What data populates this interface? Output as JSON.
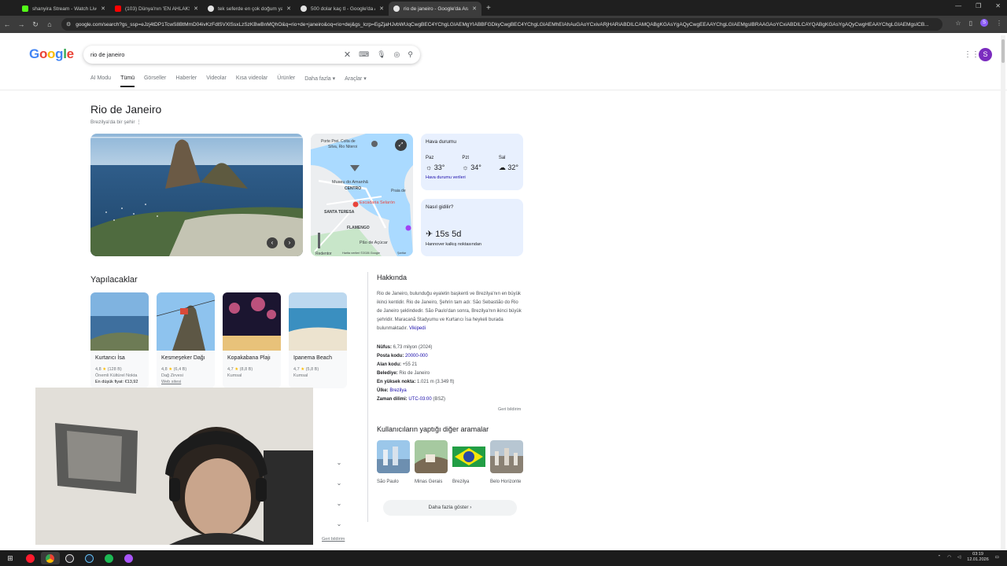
{
  "browser": {
    "tabs": [
      {
        "label": "shanyira Stream - Watch Live o",
        "color": "#53fc18",
        "active": false
      },
      {
        "label": "(103) Dünya'nın 'EN AHLAKSIZ'",
        "color": "#ff0000",
        "active": false
      },
      {
        "label": "tek seferde en çok doğum yapa",
        "color": "#e3e3e3",
        "active": false
      },
      {
        "label": "500 dolar kaç tl - Google'da Ara",
        "color": "#e3e3e3",
        "active": false
      },
      {
        "label": "rio de janeiro - Google'da Ara",
        "color": "#e3e3e3",
        "active": true
      }
    ],
    "url": "google.com/search?gs_ssp=eJzj4tDP1TcwS8BtMmD04ivKzFdlSVXlSsxLzSzKBwBnMQhO&q=rio+de+janeiro&oq=rio+dej&gs_lcrp=EgZjaHJvbWUqCwgBEC4YChgLGIAEMgYIABBFGDkyCwgBEC4YChgLGIAEMhEIAhAuGAoYCxivARjHARiABDILCAMQABgKGAsYgAQyCwgEEAAYChgLGIAEMgsIBRAAGAoYCxiABDILCAYQABgKGAsYgAQyCwgHEAAYChgLGIAEMgsICB..."
  },
  "search": {
    "query": "rio de janeiro",
    "nav_tabs": [
      "AI Modu",
      "Tümü",
      "Görseller",
      "Haberler",
      "Videolar",
      "Kısa videolar",
      "Ürünler",
      "Daha fazla ▾",
      "Araçlar ▾"
    ],
    "selected_tab": "Tümü",
    "avatar_letter": "S"
  },
  "entity": {
    "title": "Rio de Janeiro",
    "subtitle": "Brezilya'da bir şehir",
    "map_labels": {
      "porte": "Porte Prei. Colta de",
      "silva": "Silva, Rio Niteroi",
      "museu": "Museu do Amanhã",
      "centro": "CENTRO",
      "escadaria": "Escadaria Selarón",
      "santa": "SANTA TERESA",
      "flamengo": "FLAMENGO",
      "pao": "Pão de Açúcar",
      "redentor": "Redentor",
      "praia": "Praia de",
      "credit": "Harita verileri ©2026 Google",
      "terms": "Şartlar"
    },
    "weather": {
      "title": "Hava durumu",
      "days": [
        {
          "name": "Paz",
          "temp": "33°",
          "icon": "☼"
        },
        {
          "name": "Pzt",
          "temp": "34°",
          "icon": "☼"
        },
        {
          "name": "Sal",
          "temp": "32°",
          "icon": "☁"
        }
      ],
      "source": "Hava durumu verileri"
    },
    "travel": {
      "title": "Nasıl gidilir?",
      "time": "15s 5d",
      "from": "Hannover kalkış noktasından"
    }
  },
  "todo": {
    "title": "Yapılacaklar",
    "cards": [
      {
        "name": "Kurtarıcı İsa",
        "rating": "4,8",
        "reviews": "(128 B)",
        "cat": "Önemli Kültürel Nokta",
        "extra": "En düşük fiyat: €13,92",
        "extra_link": false
      },
      {
        "name": "Kesmeşeker Dağı",
        "rating": "4,8",
        "reviews": "(6,4 B)",
        "cat": "Dağ Zirvesi",
        "extra": "Web sitesi",
        "extra_link": true
      },
      {
        "name": "Kopakabana Plajı",
        "rating": "4,7",
        "reviews": "(8,8 B)",
        "cat": "Kumsal",
        "extra": "",
        "extra_link": false
      },
      {
        "name": "Ipanema Beach",
        "rating": "4,7",
        "reviews": "(5,8 B)",
        "cat": "Kumsal",
        "extra": "",
        "extra_link": false
      }
    ],
    "feedback": "Geri bildirim"
  },
  "about": {
    "title": "Hakkında",
    "text": "Rio de Janeiro, bulunduğu eyaletin başkenti ve Brezilya'nın en büyük ikinci kentidir. Rio de Janeiro, Şehrin tam adı: São Sebastião do Rio de Janeiro şeklindedir. São Paulo'dan sonra, Brezilya'nın ikinci büyük şehridir. Maracanã Stadyumu ve Kurtarıcı İsa heykeli burada bulunmaktadır.",
    "source": "Vikipedi",
    "facts": [
      {
        "label": "Nüfus:",
        "value": "6,73 milyon (2024)",
        "link": false
      },
      {
        "label": "Posta kodu:",
        "value": "20000-000",
        "link": true
      },
      {
        "label": "Alan kodu:",
        "value": "+55 21",
        "link": false
      },
      {
        "label": "Belediye:",
        "value": "Rio de Janeiro",
        "link": false
      },
      {
        "label": "En yüksek nokta:",
        "value": "1.021 m (3.349 ft)",
        "link": false
      },
      {
        "label": "Ülke:",
        "value": "Brezilya",
        "link": true
      },
      {
        "label": "Zaman dilimi:",
        "value": "UTC-03:00",
        "link": true,
        "suffix": " (BSZ)"
      }
    ],
    "feedback": "Geri bildirim"
  },
  "also_searched": {
    "title": "Kullanıcıların yaptığı diğer aramalar",
    "items": [
      {
        "name": "São Paulo"
      },
      {
        "name": "Minas Gerais"
      },
      {
        "name": "Brezilya"
      },
      {
        "name": "Belo Horizonte"
      }
    ],
    "more": "Daha fazla göster"
  },
  "taskbar": {
    "time": "03:19",
    "date": "12.01.2026"
  }
}
